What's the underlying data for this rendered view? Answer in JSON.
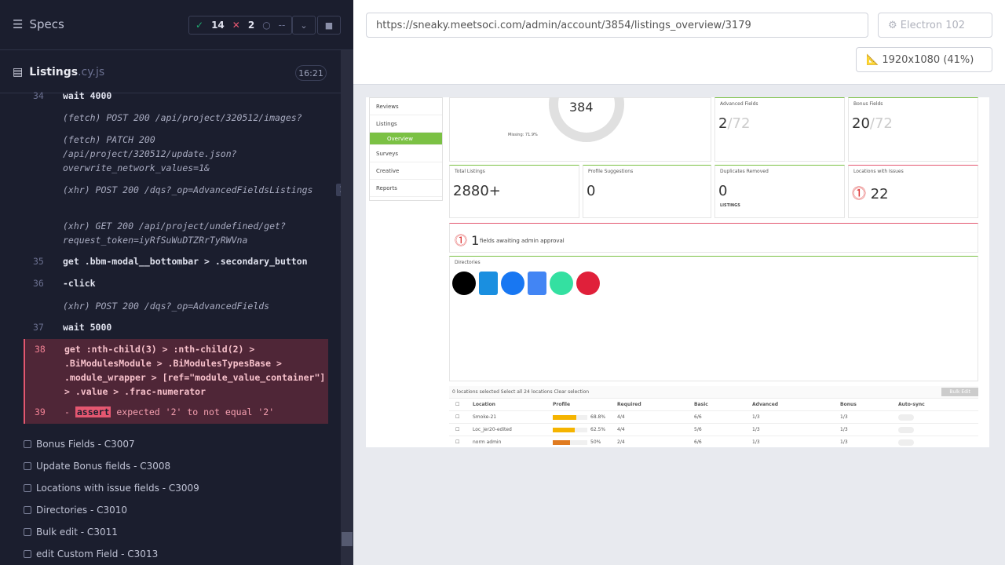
{
  "specs_header": {
    "title": "Specs",
    "passed": "14",
    "failed": "2",
    "pending": "--"
  },
  "file": {
    "name": "Listings",
    "ext": ".cy.js",
    "time": "16:21"
  },
  "commands": [
    {
      "line": "34",
      "text": "wait  4000"
    },
    {
      "line": "",
      "text": "(fetch)  POST 200 /api/project/320512/images?"
    },
    {
      "line": "",
      "text": "(fetch)  PATCH 200 /api/project/320512/update.json?overwrite_network_values=1&"
    },
    {
      "line": "",
      "text": "(xhr)  POST 200 /dqs?_op=AdvancedFieldsListings",
      "badge": "2"
    },
    {
      "line": "",
      "text": "(xhr)  GET 200 /api/project/undefined/get?request_token=iyRfSuWuDTZRrTyRWVna"
    },
    {
      "line": "35",
      "text": "get  .bbm-modal__bottombar > .secondary_button"
    },
    {
      "line": "36",
      "text": "-click"
    },
    {
      "line": "",
      "text": "(xhr)  POST 200 /dqs?_op=AdvancedFields"
    },
    {
      "line": "37",
      "text": "wait  5000"
    }
  ],
  "fail": {
    "line38": "38",
    "get_text": "get  :nth-child(3) > :nth-child(2) > .BiModulesModule > .BiModulesTypesBase > .module_wrapper > [ref=\"module_value_container\"] > .value > .frac-numerator",
    "line39": "39",
    "assert_label": "assert",
    "assert_text": "expected  '2'  to not equal  '2'"
  },
  "tests": [
    "Bonus Fields - C3007",
    "Update Bonus fields - C3008",
    "Locations with issue fields - C3009",
    "Directories - C3010",
    "Bulk edit - C3011",
    "edit Custom Field - C3013"
  ],
  "url": "https://sneaky.meetsoci.com/admin/account/3854/listings_overview/3179",
  "browser": "Electron 102",
  "viewport": "1920x1080  (41%)",
  "app": {
    "sidebar": [
      "Reviews",
      "Listings",
      "Overview",
      "Surveys",
      "Creative",
      "Reports"
    ],
    "donut_value": "384",
    "missing": "Missing: 71.9%",
    "advanced_fields": {
      "label": "Advanced Fields",
      "value": "2",
      "total": "/72"
    },
    "bonus_fields": {
      "label": "Bonus Fields",
      "value": "20",
      "total": "/72"
    },
    "total_listings": {
      "label": "Total Listings",
      "value": "2880+"
    },
    "profile_suggestions": {
      "label": "Profile Suggestions",
      "value": "0"
    },
    "duplicates": {
      "label": "Duplicates Removed",
      "value": "0",
      "sub": "LISTINGS"
    },
    "issues": {
      "label": "Locations with Issues",
      "value": "22"
    },
    "approval": {
      "value": "1",
      "text": "fields awaiting admin approval"
    },
    "directories_label": "Directories",
    "table_top": "0 locations selected  Select all 24 locations  Clear selection",
    "bulk_edit": "Bulk Edit",
    "columns": [
      "Location",
      "Profile",
      "Required",
      "Basic",
      "Advanced",
      "Bonus",
      "Auto-sync"
    ],
    "rows": [
      {
        "name": "Smoke-21",
        "pct": "68.8%",
        "req": "4/4",
        "basic": "6/6",
        "adv": "1/3",
        "bonus": "1/3"
      },
      {
        "name": "Loc_jer20-edited",
        "pct": "62.5%",
        "req": "4/4",
        "basic": "5/6",
        "adv": "1/3",
        "bonus": "1/3"
      },
      {
        "name": "norm admin",
        "pct": "50%",
        "req": "2/4",
        "basic": "6/6",
        "adv": "1/3",
        "bonus": "1/3"
      }
    ]
  }
}
